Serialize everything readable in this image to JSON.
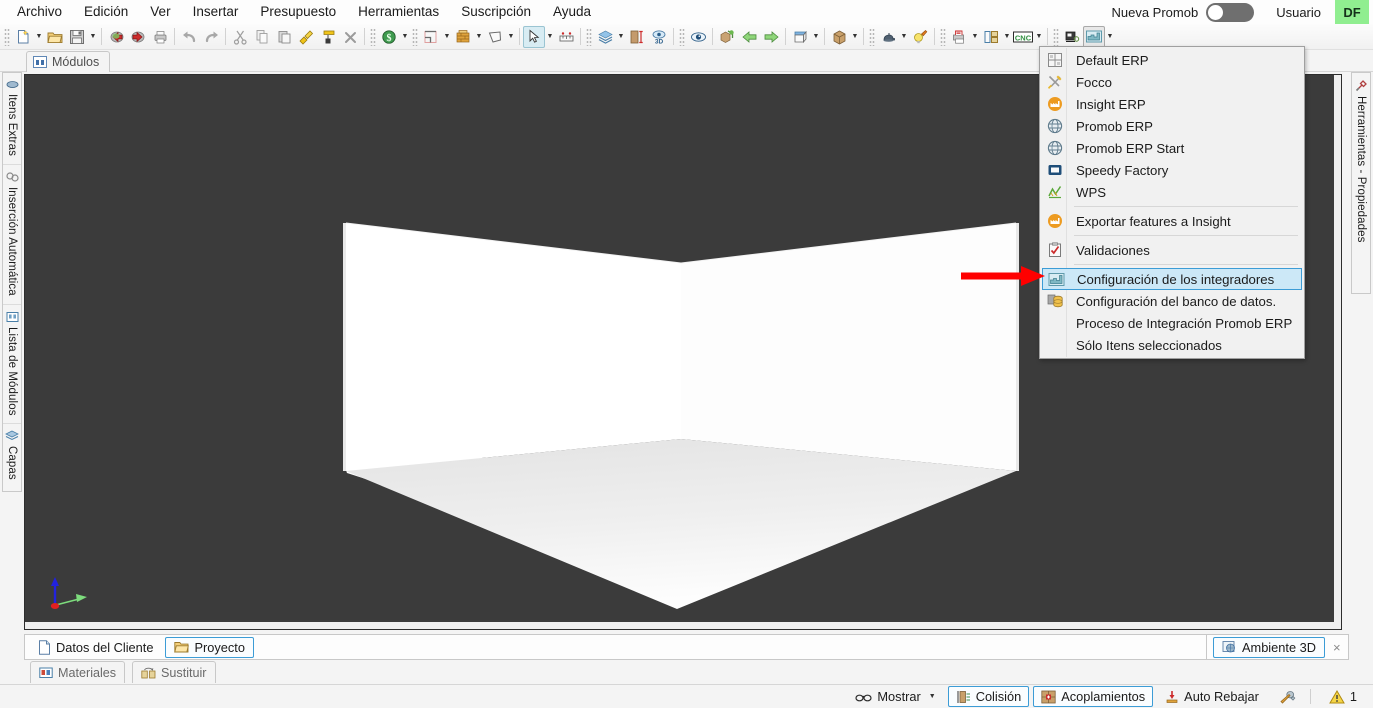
{
  "menubar": {
    "items": [
      {
        "label": "Archivo",
        "name": "menu-archivo"
      },
      {
        "label": "Edición",
        "name": "menu-edicion"
      },
      {
        "label": "Ver",
        "name": "menu-ver"
      },
      {
        "label": "Insertar",
        "name": "menu-insertar"
      },
      {
        "label": "Presupuesto",
        "name": "menu-presupuesto"
      },
      {
        "label": "Herramientas",
        "name": "menu-herramientas"
      },
      {
        "label": "Suscripción",
        "name": "menu-suscripcion"
      },
      {
        "label": "Ayuda",
        "name": "menu-ayuda"
      }
    ],
    "nueva_promob_label": "Nueva Promob",
    "nueva_promob_state": "off",
    "usuario_label": "Usuario",
    "avatar_initials": "DF",
    "avatar_color": "#90ee90"
  },
  "toolbar": {
    "groups": [
      {
        "buttons": [
          {
            "name": "new-file-button",
            "icon": "new-document-icon",
            "dropdown": true
          },
          {
            "name": "open-file-button",
            "icon": "open-folder-icon",
            "dropdown": false
          },
          {
            "name": "save-button",
            "icon": "floppy-disk-icon",
            "dropdown": true
          }
        ]
      },
      {
        "buttons": [
          {
            "name": "import-button",
            "icon": "import-green-arrow-icon",
            "dropdown": false
          },
          {
            "name": "export-button",
            "icon": "export-red-arrow-icon",
            "dropdown": false
          },
          {
            "name": "print-button",
            "icon": "printer-icon",
            "dropdown": false
          }
        ]
      },
      {
        "buttons": [
          {
            "name": "undo-button",
            "icon": "undo-arrow-icon",
            "dropdown": false
          },
          {
            "name": "redo-button",
            "icon": "redo-arrow-icon",
            "dropdown": false
          }
        ]
      },
      {
        "buttons": [
          {
            "name": "cut-button",
            "icon": "scissors-icon",
            "dropdown": false
          },
          {
            "name": "copy-button",
            "icon": "copy-icon",
            "dropdown": false
          },
          {
            "name": "paste-button",
            "icon": "paste-icon",
            "dropdown": false
          },
          {
            "name": "format-painter-button",
            "icon": "paint-brush-icon",
            "dropdown": false
          },
          {
            "name": "eyedropper-button",
            "icon": "color-roller-icon",
            "dropdown": false
          },
          {
            "name": "delete-button",
            "icon": "delete-x-icon",
            "dropdown": false
          }
        ]
      },
      {
        "buttons": [
          {
            "name": "budget-button",
            "icon": "dollar-icon",
            "dropdown": true
          }
        ]
      },
      {
        "buttons": [
          {
            "name": "environment-button",
            "icon": "room-plan-icon",
            "dropdown": true
          },
          {
            "name": "wall-button",
            "icon": "brick-wall-icon",
            "dropdown": true
          },
          {
            "name": "shape-button",
            "icon": "polygon-icon",
            "dropdown": true
          }
        ]
      },
      {
        "buttons": [
          {
            "name": "select-tool-button",
            "icon": "cursor-arrow-icon",
            "dropdown": true,
            "active": true
          },
          {
            "name": "measure-tool-button",
            "icon": "ruler-icon",
            "dropdown": false
          }
        ]
      },
      {
        "buttons": [
          {
            "name": "layers-button",
            "icon": "layers-stack-icon",
            "dropdown": true
          },
          {
            "name": "height-button",
            "icon": "height-measure-icon",
            "dropdown": false
          },
          {
            "name": "view-3d-button",
            "icon": "view-3d-icon",
            "dropdown": false
          }
        ]
      },
      {
        "buttons": [
          {
            "name": "visibility-button",
            "icon": "eye-icon",
            "dropdown": false
          }
        ]
      },
      {
        "buttons": [
          {
            "name": "duplicate-button",
            "icon": "duplicate-box-icon",
            "dropdown": false
          },
          {
            "name": "rotate-left-button",
            "icon": "arrow-left-green-icon",
            "dropdown": false
          },
          {
            "name": "rotate-right-button",
            "icon": "arrow-right-green-icon",
            "dropdown": false
          }
        ]
      },
      {
        "buttons": [
          {
            "name": "camera-view-button",
            "icon": "perspective-box-icon",
            "dropdown": true
          }
        ]
      },
      {
        "buttons": [
          {
            "name": "package-button",
            "icon": "cardboard-box-icon",
            "dropdown": true
          }
        ]
      },
      {
        "buttons": [
          {
            "name": "render-button",
            "icon": "lamp-icon",
            "dropdown": true
          },
          {
            "name": "light-button",
            "icon": "lightbulb-icon",
            "dropdown": false
          }
        ]
      },
      {
        "buttons": [
          {
            "name": "report-button",
            "icon": "print-report-icon",
            "dropdown": true
          },
          {
            "name": "panel-layout-button",
            "icon": "panels-icon",
            "dropdown": true
          },
          {
            "name": "cnc-button",
            "icon": "cnc-icon",
            "dropdown": true
          }
        ]
      },
      {
        "buttons": [
          {
            "name": "presentation-button",
            "icon": "presentation-icon",
            "dropdown": false
          },
          {
            "name": "integrators-button",
            "icon": "factory-chart-icon",
            "dropdown": true,
            "active_plain": true
          }
        ]
      }
    ]
  },
  "modules_tab": {
    "label": "Módulos",
    "icon": "modules-grid-icon"
  },
  "left_dock": {
    "items": [
      {
        "label": "Itens Extras",
        "icon": "extra-items-icon",
        "name": "dock-item-itens-extras"
      },
      {
        "label": "Inserción Automática",
        "icon": "auto-insert-icon",
        "name": "dock-item-insercion-automatica"
      },
      {
        "label": "Lista de Módulos",
        "icon": "module-list-icon",
        "name": "dock-item-lista-de-modulos"
      },
      {
        "label": "Capas",
        "icon": "layers-icon",
        "name": "dock-item-capas"
      }
    ]
  },
  "right_dock": {
    "items": [
      {
        "label": "Herramientas - Propiedades",
        "icon": "tools-properties-icon",
        "name": "dock-item-herramientas-propiedades"
      }
    ]
  },
  "dropdown_menu": {
    "items": [
      {
        "label": "Default ERP",
        "icon": "grid-squares-icon",
        "selected": false,
        "separator_after": false
      },
      {
        "label": "Focco",
        "icon": "tools-cross-icon",
        "selected": false,
        "separator_after": false
      },
      {
        "label": "Insight ERP",
        "icon": "orange-factory-icon",
        "selected": false,
        "separator_after": false
      },
      {
        "label": "Promob ERP",
        "icon": "globe-icon",
        "selected": false,
        "separator_after": false
      },
      {
        "label": "Promob ERP Start",
        "icon": "globe-icon",
        "selected": false,
        "separator_after": false
      },
      {
        "label": "Speedy Factory",
        "icon": "blue-box-icon",
        "selected": false,
        "separator_after": false
      },
      {
        "label": "WPS",
        "icon": "green-chart-icon",
        "selected": false,
        "separator_after": true
      },
      {
        "label": "Exportar features a Insight",
        "icon": "orange-factory-icon",
        "selected": false,
        "separator_after": true
      },
      {
        "label": "Validaciones",
        "icon": "clipboard-check-icon",
        "selected": false,
        "separator_after": true
      },
      {
        "label": "Configuración de los integradores",
        "icon": "factory-chart-icon",
        "selected": true,
        "separator_after": false
      },
      {
        "label": "Configuración del banco de datos.",
        "icon": "database-icon",
        "selected": false,
        "separator_after": false
      },
      {
        "label": "Proceso de Integración Promob ERP",
        "icon": "none",
        "selected": false,
        "separator_after": false
      },
      {
        "label": "Sólo Itens seleccionados",
        "icon": "none",
        "selected": false,
        "separator_after": false
      }
    ],
    "highlight_color": "#cce8f7",
    "highlight_border": "#3c9cd6"
  },
  "annotation": {
    "arrow_color": "#ff0000",
    "points_to": "Configuración de los integradores"
  },
  "viewport": {
    "background_color": "#3b3b3b",
    "axis_gizmo": {
      "z_axis_color": "#2222dd",
      "y_axis_color": "#7ddc7d",
      "origin_color": "#e02020"
    }
  },
  "bottom_tabs": {
    "items": [
      {
        "label": "Datos del Cliente",
        "icon": "document-icon",
        "active": false,
        "name": "tab-datos-del-cliente"
      },
      {
        "label": "Proyecto",
        "icon": "folder-open-icon",
        "active": true,
        "name": "tab-proyecto"
      }
    ],
    "ambiente": {
      "label": "Ambiente 3D",
      "icon": "ambiente-3d-icon",
      "close": "×"
    }
  },
  "materials_tabs": {
    "items": [
      {
        "label": "Materiales",
        "icon": "materials-swatch-icon",
        "name": "tab-materiales"
      },
      {
        "label": "Sustituir",
        "icon": "replace-icon",
        "name": "tab-sustituir"
      }
    ]
  },
  "statusbar": {
    "items": [
      {
        "label": "Mostrar",
        "icon": "glasses-icon",
        "dropdown": true,
        "boxed": false,
        "name": "status-mostrar"
      },
      {
        "label": "Colisión",
        "icon": "collision-icon",
        "dropdown": false,
        "boxed": true,
        "name": "status-colision"
      },
      {
        "label": "Acoplamientos",
        "icon": "coupling-icon",
        "dropdown": false,
        "boxed": true,
        "name": "status-acoplamientos"
      },
      {
        "label": "Auto Rebajar",
        "icon": "auto-notch-icon",
        "dropdown": false,
        "boxed": false,
        "name": "status-auto-rebajar"
      }
    ],
    "wrench_icon": "wrench-icon",
    "warning_count": "1",
    "warning_icon": "warning-triangle-icon"
  }
}
